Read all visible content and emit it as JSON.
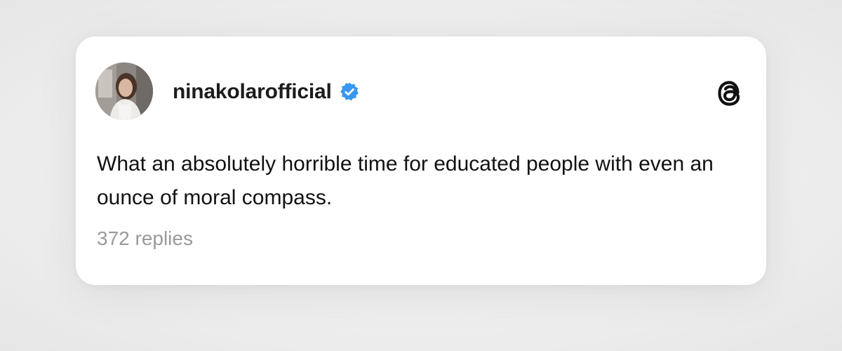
{
  "post": {
    "username": "ninakolarofficial",
    "verified": true,
    "text": "What an absolutely horrible time for educated people with even an ounce of moral compass.",
    "replies": "372 replies"
  },
  "icons": {
    "verified_badge": "verified-check-icon",
    "brand_logo": "threads-logo-icon"
  },
  "colors": {
    "verified_blue": "#3897f0",
    "text_primary": "#111111",
    "text_secondary": "#9a9a9a",
    "card_background": "#ffffff"
  }
}
